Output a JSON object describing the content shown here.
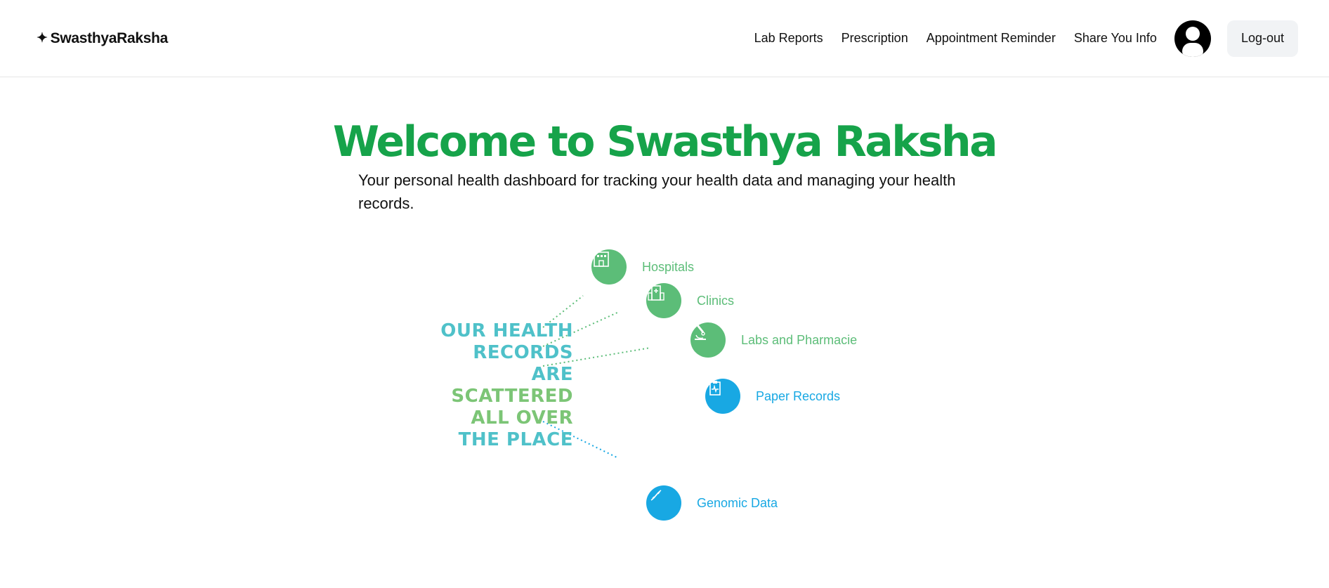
{
  "navbar": {
    "brand_icon": "✦",
    "brand": "SwasthyaRaksha",
    "links": [
      "Lab Reports",
      "Prescription",
      "Appointment Reminder",
      "Share You Info"
    ],
    "logout": "Log-out"
  },
  "hero": {
    "title": "Welcome to Swasthya Raksha",
    "subtitle": "Your personal health dashboard for tracking your health data and managing your health records."
  },
  "illustration": {
    "scattered_lines": [
      "OUR HEALTH",
      "RECORDS",
      "ARE",
      "SCATTERED",
      "ALL OVER",
      "THE PLACE"
    ],
    "nodes": [
      {
        "label": "Hospitals",
        "icon": "hospital-icon",
        "color": "green"
      },
      {
        "label": "Clinics",
        "icon": "clinic-icon",
        "color": "green"
      },
      {
        "label": "Labs and Pharmacie",
        "icon": "microscope-icon",
        "color": "green"
      },
      {
        "label": "Paper Records",
        "icon": "clipboard-icon",
        "color": "blue"
      },
      {
        "label": "Genomic Data",
        "icon": "dna-icon",
        "color": "blue"
      }
    ],
    "colors": {
      "green": "#5cbd78",
      "blue": "#18a8e3",
      "teal_text": "#4fc1c9",
      "green_text": "#7cc576",
      "title_green": "#16a34a"
    }
  }
}
